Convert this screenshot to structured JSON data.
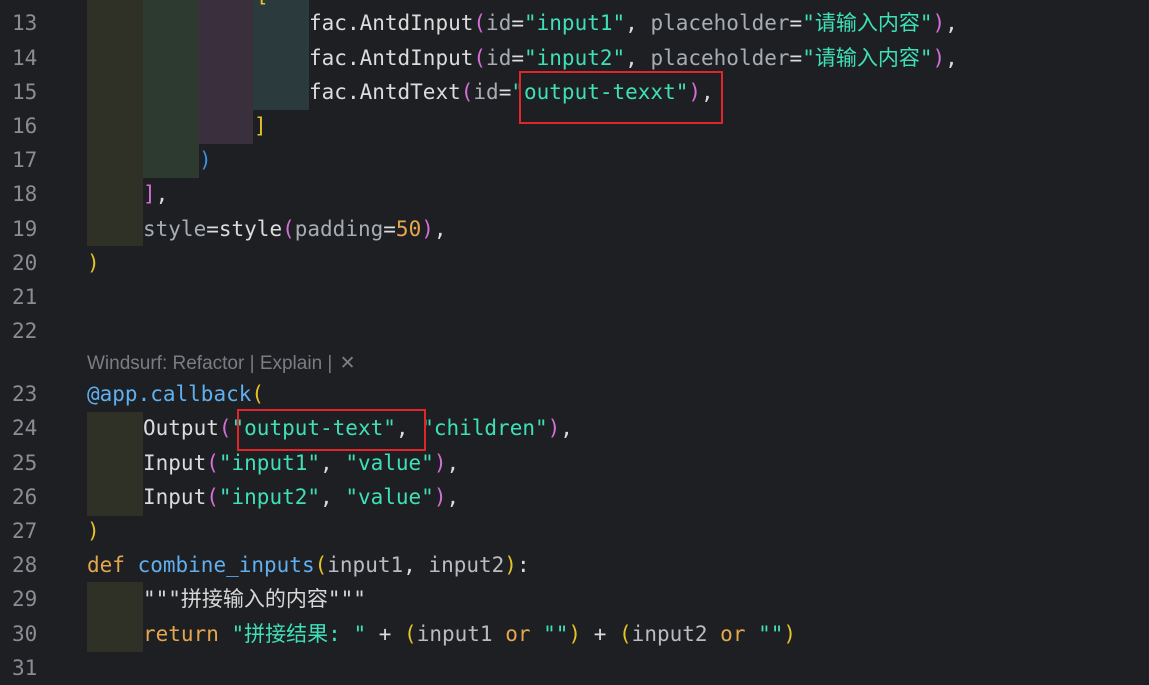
{
  "editor": {
    "line_numbers": [
      "13",
      "14",
      "15",
      "16",
      "17",
      "18",
      "19",
      "20",
      "21",
      "22",
      "23",
      "24",
      "25",
      "26",
      "27",
      "28",
      "29",
      "30",
      "31"
    ],
    "codelens": {
      "text": "Windsurf: Refactor | Explain | ",
      "close_glyph": "✕"
    },
    "lines": {
      "l13": {
        "obj": "fac",
        "dot": ".",
        "fn": "AntdInput",
        "open": "(",
        "k": "id",
        "eq": "=",
        "v": "\"input1\"",
        "c": ", ",
        "k2": "placeholder",
        "eq2": "=",
        "v2": "\"请输入内容\"",
        "close": ")",
        "end": ","
      },
      "l14": {
        "obj": "fac",
        "dot": ".",
        "fn": "AntdInput",
        "open": "(",
        "k": "id",
        "eq": "=",
        "v": "\"input2\"",
        "c": ", ",
        "k2": "placeholder",
        "eq2": "=",
        "v2": "\"请输入内容\"",
        "close": ")",
        "end": ","
      },
      "l15": {
        "obj": "fac",
        "dot": ".",
        "fn": "AntdText",
        "open": "(",
        "k": "id",
        "eq": "=",
        "v": "\"output-texxt\"",
        "close": ")",
        "end": ","
      },
      "l16": {
        "br": "]"
      },
      "l17": {
        "br": ")"
      },
      "l18": {
        "br": "]",
        "end": ","
      },
      "l19": {
        "k": "style",
        "eq": "=",
        "fn": "style",
        "open": "(",
        "k2": "padding",
        "eq2": "=",
        "num": "50",
        "close": ")",
        "end": ","
      },
      "l20": {
        "br": ")"
      },
      "l23": {
        "dec": "@app",
        "dot": ".",
        "fn": "callback",
        "open": "("
      },
      "l24": {
        "fn": "Output",
        "open": "(",
        "v": "\"output-text\"",
        "c": ", ",
        "v2": "\"children\"",
        "close": ")",
        "end": ","
      },
      "l25": {
        "fn": "Input",
        "open": "(",
        "v": "\"input1\"",
        "c": ", ",
        "v2": "\"value\"",
        "close": ")",
        "end": ","
      },
      "l26": {
        "fn": "Input",
        "open": "(",
        "v": "\"input2\"",
        "c": ", ",
        "v2": "\"value\"",
        "close": ")",
        "end": ","
      },
      "l27": {
        "br": ")"
      },
      "l28": {
        "kw": "def",
        "sp": " ",
        "fn": "combine_inputs",
        "open": "(",
        "p1": "input1",
        "c": ", ",
        "p2": "input2",
        "close": ")",
        "end": ":"
      },
      "l29": {
        "doc": "\"\"\"拼接输入的内容\"\"\""
      },
      "l30": {
        "kw": "return",
        "sp": " ",
        "v": "\"拼接结果: \"",
        "op": " + ",
        "o1": "(",
        "p1": "input1",
        "or1": " or ",
        "v1": "\"\"",
        "c1": ")",
        "op2": " + ",
        "o2": "(",
        "p2": "input2",
        "or2": " or ",
        "v2": "\"\"",
        "c2": ")"
      }
    }
  }
}
